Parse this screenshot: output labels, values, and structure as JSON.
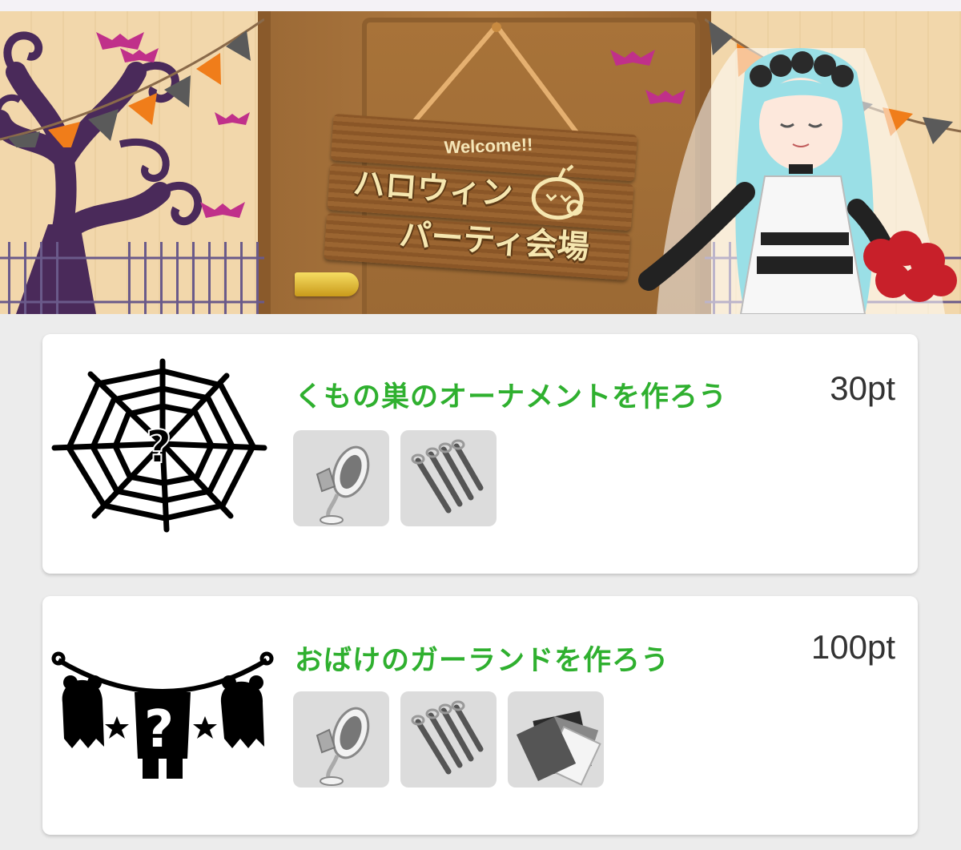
{
  "banner": {
    "sign": {
      "welcome": "Welcome!!",
      "line1": "ハロウィン",
      "line2": "パーティ会場"
    },
    "colors": {
      "bunting_orange": "#f07d1a",
      "bunting_gray": "#5a5a5a",
      "bat": "#c0308a",
      "tree": "#4a2a5a"
    }
  },
  "missions": [
    {
      "title": "くもの巣のオーナメントを作ろう",
      "points": "30pt",
      "art_icon": "spiderweb-silhouette-icon",
      "materials": [
        {
          "icon": "glue-bottle-icon"
        },
        {
          "icon": "thread-bundle-icon"
        }
      ]
    },
    {
      "title": "おばけのガーランドを作ろう",
      "points": "100pt",
      "art_icon": "ghost-garland-silhouette-icon",
      "materials": [
        {
          "icon": "glue-bottle-icon"
        },
        {
          "icon": "thread-bundle-icon"
        },
        {
          "icon": "paper-sheets-icon"
        }
      ]
    }
  ],
  "colors": {
    "title_green": "#2fb02f",
    "points_text": "#333333",
    "material_bg": "#dcdcdc"
  }
}
